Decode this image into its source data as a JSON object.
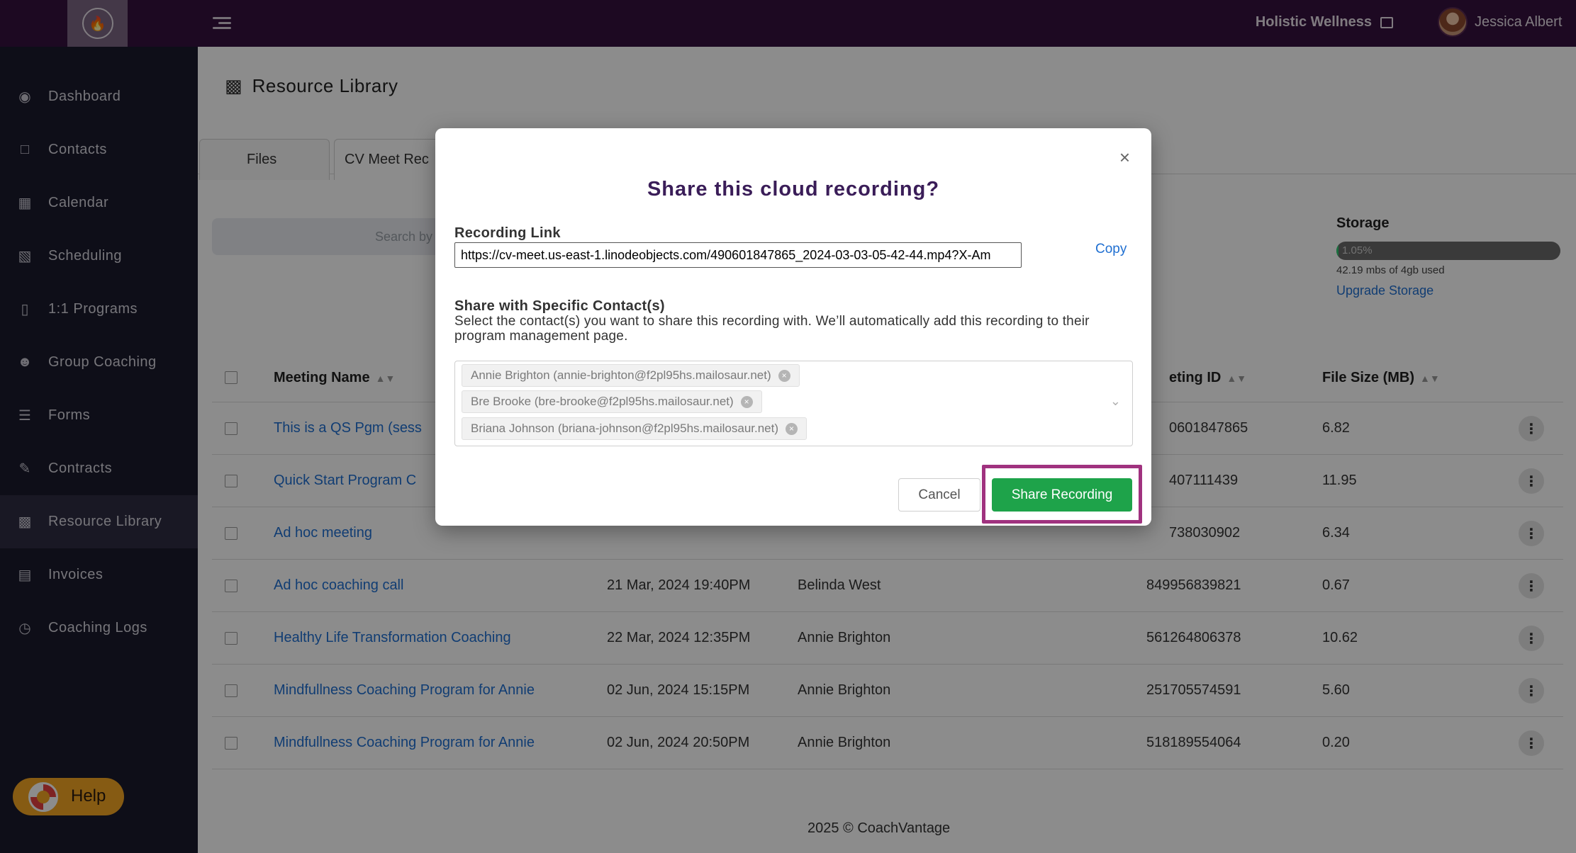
{
  "topbar": {
    "org_name": "Holistic Wellness",
    "user_name": "Jessica Albert"
  },
  "sidebar": {
    "items": [
      {
        "label": "Dashboard",
        "icon": "dashboard-icon"
      },
      {
        "label": "Contacts",
        "icon": "contacts-icon"
      },
      {
        "label": "Calendar",
        "icon": "calendar-icon"
      },
      {
        "label": "Scheduling",
        "icon": "scheduling-icon"
      },
      {
        "label": "1:1 Programs",
        "icon": "book-icon"
      },
      {
        "label": "Group Coaching",
        "icon": "group-icon"
      },
      {
        "label": "Forms",
        "icon": "forms-icon"
      },
      {
        "label": "Contracts",
        "icon": "contracts-icon"
      },
      {
        "label": "Resource Library",
        "icon": "library-icon"
      },
      {
        "label": "Invoices",
        "icon": "invoice-icon"
      },
      {
        "label": "Coaching Logs",
        "icon": "clock-icon"
      }
    ],
    "active_index": 8,
    "help_label": "Help"
  },
  "main": {
    "page_title": "Resource Library",
    "tabs": [
      {
        "label": "Files"
      },
      {
        "label": "CV Meet Rec"
      }
    ],
    "search_placeholder": "Search by",
    "storage": {
      "title": "Storage",
      "percent_label": "1.05%",
      "percent": 1.05,
      "used_text": "42.19 mbs of 4gb used",
      "upgrade_label": "Upgrade Storage"
    },
    "table": {
      "headers": [
        "Meeting Name",
        "eting ID",
        "File Size (MB)"
      ],
      "rows": [
        {
          "name": "This is a QS Pgm (sess",
          "date": "",
          "contact": "",
          "id": "0601847865",
          "size": "6.82"
        },
        {
          "name": "Quick Start Program C",
          "date": "",
          "contact": "",
          "id": "407111439",
          "size": "11.95"
        },
        {
          "name": "Ad hoc meeting",
          "date": "",
          "contact": "",
          "id": "738030902",
          "size": "6.34"
        },
        {
          "name": "Ad hoc coaching call",
          "date": "21 Mar, 2024 19:40PM",
          "contact": "Belinda West",
          "id": "849956839821",
          "size": "0.67"
        },
        {
          "name": "Healthy Life Transformation Coaching",
          "date": "22 Mar, 2024 12:35PM",
          "contact": "Annie Brighton",
          "id": "561264806378",
          "size": "10.62"
        },
        {
          "name": "Mindfullness Coaching Program for Annie",
          "date": "02 Jun, 2024 15:15PM",
          "contact": "Annie Brighton",
          "id": "251705574591",
          "size": "5.60"
        },
        {
          "name": "Mindfullness Coaching Program for Annie",
          "date": "02 Jun, 2024 20:50PM",
          "contact": "Annie Brighton",
          "id": "518189554064",
          "size": "0.20"
        }
      ]
    },
    "footer": "2025 © CoachVantage"
  },
  "modal": {
    "title": "Share this cloud recording?",
    "recording_link_label": "Recording Link",
    "recording_link_value": "https://cv-meet.us-east-1.linodeobjects.com/490601847865_2024-03-03-05-42-44.mp4?X-Am",
    "copy_label": "Copy",
    "share_label": "Share with Specific Contact(s)",
    "share_desc": "Select the contact(s) you want to share this recording with. We’ll automatically add this recording to their program management page.",
    "contacts": [
      "Annie Brighton (annie-brighton@f2pl95hs.mailosaur.net)",
      "Bre Brooke (bre-brooke@f2pl95hs.mailosaur.net)",
      "Briana Johnson (briana-johnson@f2pl95hs.mailosaur.net)"
    ],
    "cancel_label": "Cancel",
    "share_button_label": "Share Recording"
  },
  "colors": {
    "topbar": "#36123f",
    "sidebar": "#1a1a2d",
    "accent_link": "#1f6fd1",
    "share_button": "#1ea34a",
    "highlight": "#a0327f",
    "modal_title": "#3a1d58"
  }
}
